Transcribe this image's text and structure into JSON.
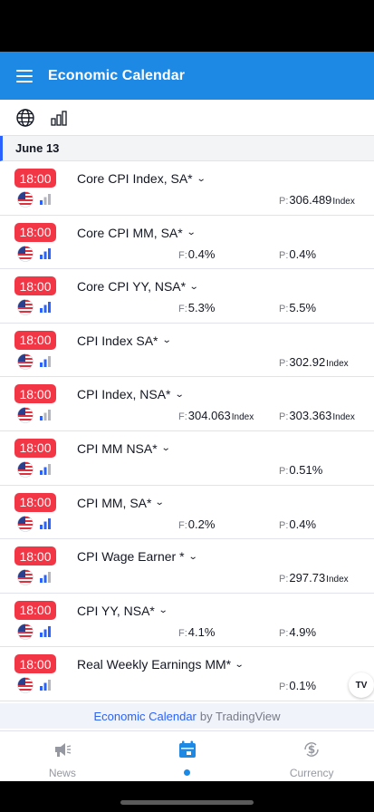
{
  "app_bar": {
    "title": "Economic Calendar"
  },
  "toolbar": {
    "icons": [
      "globe-icon",
      "importance-filter-icon"
    ]
  },
  "date_header": "June 13",
  "labels": {
    "forecast": "F:",
    "previous": "P:"
  },
  "events": [
    {
      "time": "18:00",
      "title": "Core CPI Index, SA*",
      "importance": 1,
      "forecast": "",
      "forecast_unit": "",
      "previous": "306.489",
      "previous_unit": "Index"
    },
    {
      "time": "18:00",
      "title": "Core CPI MM, SA*",
      "importance": 3,
      "forecast": "0.4%",
      "forecast_unit": "",
      "previous": "0.4%",
      "previous_unit": ""
    },
    {
      "time": "18:00",
      "title": "Core CPI YY, NSA*",
      "importance": 3,
      "forecast": "5.3%",
      "forecast_unit": "",
      "previous": "5.5%",
      "previous_unit": ""
    },
    {
      "time": "18:00",
      "title": "CPI Index SA*",
      "importance": 2,
      "forecast": "",
      "forecast_unit": "",
      "previous": "302.92",
      "previous_unit": "Index"
    },
    {
      "time": "18:00",
      "title": "CPI Index, NSA*",
      "importance": 1,
      "forecast": "304.063",
      "forecast_unit": "Index",
      "previous": "303.363",
      "previous_unit": "Index"
    },
    {
      "time": "18:00",
      "title": "CPI MM NSA*",
      "importance": 2,
      "forecast": "",
      "forecast_unit": "",
      "previous": "0.51%",
      "previous_unit": ""
    },
    {
      "time": "18:00",
      "title": "CPI MM, SA*",
      "importance": 3,
      "forecast": "0.2%",
      "forecast_unit": "",
      "previous": "0.4%",
      "previous_unit": ""
    },
    {
      "time": "18:00",
      "title": "CPI Wage Earner *",
      "importance": 2,
      "forecast": "",
      "forecast_unit": "",
      "previous": "297.73",
      "previous_unit": "Index"
    },
    {
      "time": "18:00",
      "title": "CPI YY, NSA*",
      "importance": 3,
      "forecast": "4.1%",
      "forecast_unit": "",
      "previous": "4.9%",
      "previous_unit": ""
    },
    {
      "time": "18:00",
      "title": "Real Weekly Earnings MM*",
      "importance": 2,
      "forecast": "",
      "forecast_unit": "",
      "previous": "0.1%",
      "previous_unit": ""
    }
  ],
  "tv_badge": "TV",
  "footer_credit": {
    "link": "Economic Calendar",
    "by": "by TradingView"
  },
  "tabs": [
    {
      "label": "News",
      "icon": "megaphone-icon"
    },
    {
      "label": "",
      "icon": "calendar-icon",
      "active": true
    },
    {
      "label": "Currency",
      "icon": "currency-icon"
    }
  ],
  "colors": {
    "brand": "#1e88e5",
    "time_badge": "#f23645",
    "importance_on": "#2962ff",
    "importance_off": "#b2b5be"
  }
}
